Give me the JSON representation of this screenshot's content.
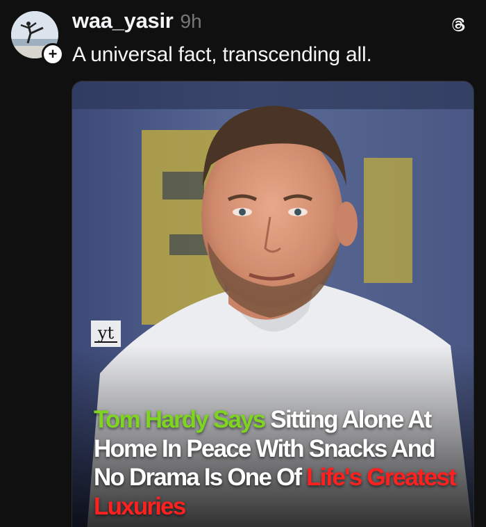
{
  "post": {
    "author": "waa_yasir",
    "timestamp": "9h",
    "caption": "A universal fact, transcending all.",
    "follow_badge": "+",
    "app_icon": "threads-icon"
  },
  "media": {
    "watermark": "yt",
    "headline": {
      "green": "Tom Hardy Says",
      "white_1": " Sitting Alone At Home In Peace With Snacks And No Drama Is One Of ",
      "red": "Life's Greatest Luxuries"
    }
  },
  "colors": {
    "background": "#101010",
    "text": "#f3f5f7",
    "muted": "#777777",
    "headline_green": "#7fd321",
    "headline_red": "#ff2020"
  }
}
